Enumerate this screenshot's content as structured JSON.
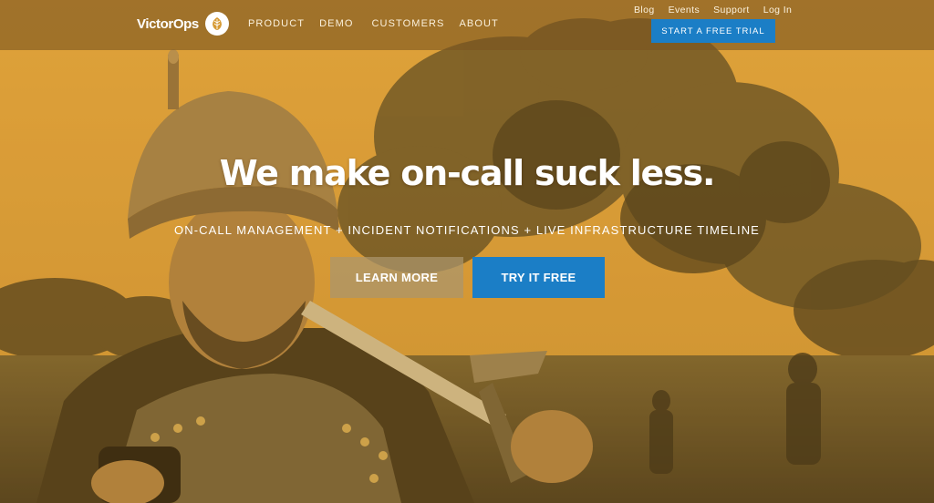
{
  "brand": {
    "logo_text": "VictorOps",
    "logo_icon": "acorn-leaf-icon"
  },
  "main_nav": {
    "items": [
      "PRODUCT",
      "DEMO",
      "CUSTOMERS",
      "ABOUT"
    ]
  },
  "util_nav": {
    "items": [
      "Blog",
      "Events",
      "Support",
      "Log In"
    ]
  },
  "header_cta": {
    "label": "START A FREE TRIAL"
  },
  "hero": {
    "title": "We make on-call suck less.",
    "subtitle": "ON-CALL MANAGEMENT + INCIDENT NOTIFICATIONS + LIVE INFRASTRUCTURE TIMELINE",
    "learn_more_label": "LEARN MORE",
    "try_free_label": "TRY IT FREE"
  },
  "colors": {
    "accent_blue": "#1b7ec6",
    "tint_orange": "#d69a34"
  }
}
